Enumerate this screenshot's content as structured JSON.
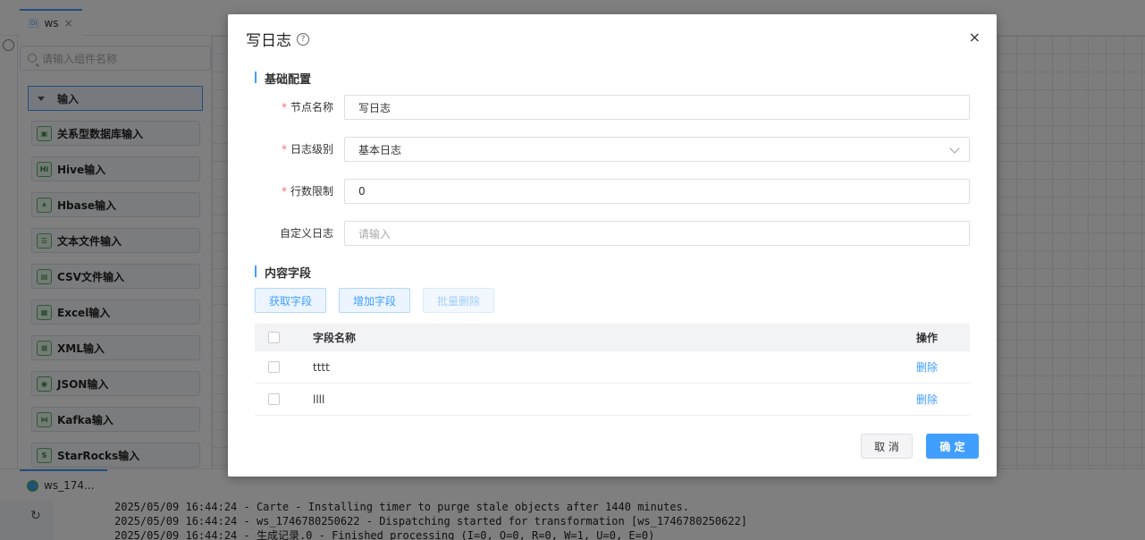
{
  "app": {
    "tab_label": "ws",
    "tab_badge": "DI",
    "search_placeholder": "请输入组件名称",
    "group_label": "输入",
    "components": [
      {
        "label": "关系型数据库输入",
        "icon": "database-icon"
      },
      {
        "label": "Hive输入",
        "icon": "hive-icon",
        "glyph": "Hi"
      },
      {
        "label": "Hbase输入",
        "icon": "hbase-icon"
      },
      {
        "label": "文本文件输入",
        "icon": "text-file-icon"
      },
      {
        "label": "CSV文件输入",
        "icon": "csv-file-icon"
      },
      {
        "label": "Excel输入",
        "icon": "excel-icon"
      },
      {
        "label": "XML输入",
        "icon": "xml-icon"
      },
      {
        "label": "JSON输入",
        "icon": "json-icon"
      },
      {
        "label": "Kafka输入",
        "icon": "kafka-icon"
      },
      {
        "label": "StarRocks输入",
        "icon": "starrocks-icon"
      }
    ],
    "bottom_tab": "ws_174...",
    "log_lines": [
      "2025/05/09 16:44:24 - Carte - Installing timer to purge stale objects after 1440 minutes.",
      "2025/05/09 16:44:24 - ws_1746780250622 - Dispatching started for transformation [ws_1746780250622]",
      "2025/05/09 16:44:24 - 生成记录.0 - Finished processing (I=0, O=0, R=0, W=1, U=0, E=0)"
    ]
  },
  "dialog": {
    "title": "写日志",
    "close_glyph": "×",
    "help_glyph": "?",
    "section_basic": "基础配置",
    "fields": {
      "node_name_label": "节点名称",
      "node_name_value": "写日志",
      "log_level_label": "日志级别",
      "log_level_value": "基本日志",
      "row_limit_label": "行数限制",
      "row_limit_value": "0",
      "custom_log_label": "自定义日志",
      "custom_log_placeholder": "请输入"
    },
    "section_content": "内容字段",
    "buttons": {
      "get_fields": "获取字段",
      "add_field": "增加字段",
      "batch_delete": "批量删除"
    },
    "table": {
      "col_name": "字段名称",
      "col_op": "操作",
      "rows": [
        {
          "name": "tttt",
          "op": "删除"
        },
        {
          "name": "llll",
          "op": "删除"
        }
      ]
    },
    "footer": {
      "cancel": "取 消",
      "confirm": "确 定"
    }
  }
}
